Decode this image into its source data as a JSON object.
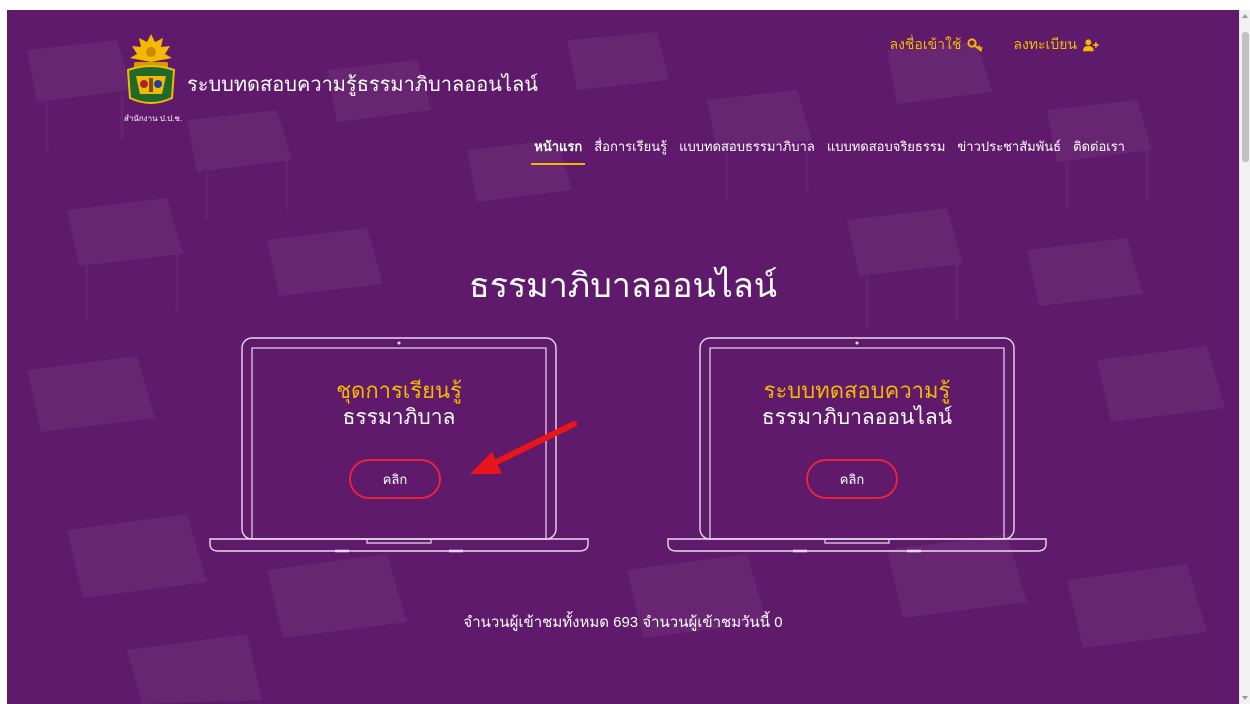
{
  "header": {
    "site_title": "ระบบทดสอบความรู้ธรรมาภิบาลออนไลน์",
    "logo_caption": "สำนักงาน ป.ป.ช.",
    "login_label": "ลงชื่อเข้าใช้",
    "register_label": "ลงทะเบียน",
    "login_icon": "key-icon",
    "register_icon": "user-plus-icon"
  },
  "nav": {
    "items": [
      {
        "label": "หน้าแรก",
        "active": true
      },
      {
        "label": "สื่อการเรียนรู้"
      },
      {
        "label": "แบบทดสอบธรรมาภิบาล"
      },
      {
        "label": "แบบทดสอบจริยธรรม"
      },
      {
        "label": "ข่าวประชาสัมพันธ์"
      },
      {
        "label": "ติดต่อเรา"
      }
    ]
  },
  "hero": {
    "title": "ธรรมาภิบาลออนไลน์"
  },
  "cards": [
    {
      "line1": "ชุดการเรียนรู้",
      "line2": "ธรรมาภิบาล",
      "button": "คลิก"
    },
    {
      "line1": "ระบบทดสอบความรู้",
      "line2": "ธรรมาภิบาลออนไลน์",
      "button": "คลิก"
    }
  ],
  "footer": {
    "visitor_text": "จำนวนผู้เข้าชมทั้งหมด 693 จำนวนผู้เข้าชมวันนี้ 0"
  },
  "colors": {
    "background": "#5f1a6b",
    "accent_yellow": "#f5b800",
    "button_border": "#e9223d",
    "arrow_red": "#e8151b"
  }
}
